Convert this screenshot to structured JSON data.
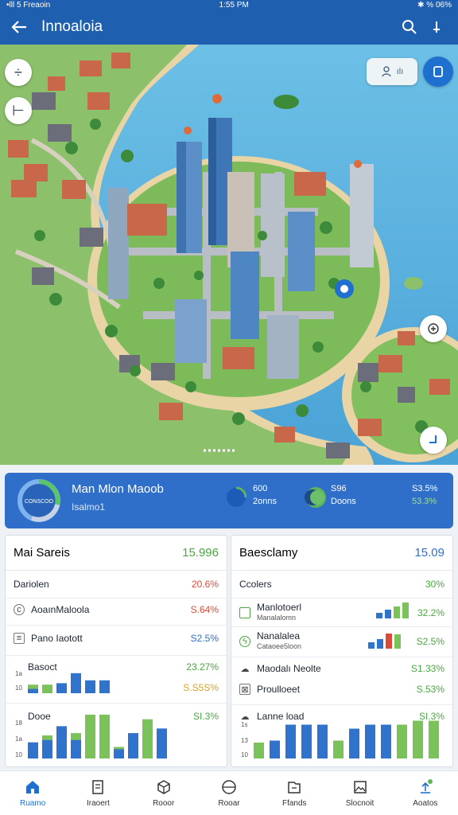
{
  "status_bar": {
    "left": "•lll 5 Freaoin",
    "time": "1:55 PM",
    "right": "✱ % 06%"
  },
  "app_bar": {
    "title": "Innoaloia",
    "back_icon": "arrow-left-icon",
    "search_icon": "search-icon",
    "menu_icon": "pin-icon"
  },
  "map": {
    "chip_text": "ılı"
  },
  "summary": {
    "title": "Man Mlon Maoob",
    "subtitle": "Isalmo1",
    "donut_label": "CONSCOO",
    "stat1_line1": "600",
    "stat1_line2": "2onns",
    "stat2_line1": "S96",
    "stat2_line2": "Doons",
    "stat3_line1": "S3.5%",
    "stat3_line2": "53.3%",
    "colors": {
      "card": "#2f6fca",
      "green": "#5cb55a",
      "blue": "#1e5bb8"
    }
  },
  "left_panel": {
    "title": "Mai Sareis",
    "total": "15.996",
    "rows": [
      {
        "label": "Dariolen",
        "value": "20.6%"
      },
      {
        "label": "AoaınMaloola",
        "value": "S.64%"
      },
      {
        "label": "Pano Iaotott",
        "value": "S2.5%"
      },
      {
        "label": "Basoct",
        "value": "23.27%"
      },
      {
        "label": "",
        "value": "S.S5S%"
      },
      {
        "label": "Dooe",
        "value": "SI.3%"
      }
    ],
    "axis1": [
      "1a",
      "10"
    ],
    "axis2": [
      "18",
      "1a",
      "10"
    ],
    "chart1": [
      {
        "blue": 0.15,
        "green": 0.3
      },
      {
        "blue": 0.0,
        "green": 0.3
      },
      {
        "blue": 0.35,
        "green": 0.3
      },
      {
        "blue": 0.7,
        "green": 0.0
      },
      {
        "blue": 0.45,
        "green": 0.0
      },
      {
        "blue": 0.45,
        "green": 0.0
      }
    ],
    "chart2": [
      {
        "blue": 0.35,
        "green": 0.0
      },
      {
        "blue": 0.4,
        "green": 0.5
      },
      {
        "blue": 0.7,
        "green": 0.0
      },
      {
        "blue": 0.4,
        "green": 0.55
      },
      {
        "blue": 0.0,
        "green": 0.95
      },
      {
        "blue": 0.0,
        "green": 0.95
      },
      {
        "blue": 0.2,
        "green": 0.25
      },
      {
        "blue": 0.55,
        "green": 0.0
      },
      {
        "blue": 0.0,
        "green": 0.85
      },
      {
        "blue": 0.65,
        "green": 0.0
      }
    ]
  },
  "right_panel": {
    "title": "Baesclamy",
    "total": "15.09",
    "rows": [
      {
        "label": "Ccolers",
        "sublabel": "",
        "value": "30%"
      },
      {
        "label": "Manlotoerl",
        "sublabel": "Manalalomn",
        "value": "32.2%"
      },
      {
        "label": "Nanalalea",
        "sublabel": "Cataoee5loon",
        "value": "S2.5%"
      },
      {
        "label": "Maodalı Neolte",
        "sublabel": "",
        "value": "S1.33%"
      },
      {
        "label": "Proulloeet",
        "sublabel": "",
        "value": "S.53%"
      },
      {
        "label": "Lanne load",
        "sublabel": "",
        "value": "SI.3%"
      }
    ],
    "axis": [
      "1s",
      "13",
      "10"
    ],
    "spark1": [
      0.35,
      0.55,
      0.75,
      1.0
    ],
    "spark2": [
      0.4,
      0.6,
      0.95,
      0.9
    ],
    "chart": [
      {
        "blue": 0.0,
        "green": 0.4
      },
      {
        "blue": 0.45,
        "green": 0.0
      },
      {
        "blue": 0.85,
        "green": 0.0
      },
      {
        "blue": 0.85,
        "green": 0.0
      },
      {
        "blue": 0.85,
        "green": 0.0
      },
      {
        "blue": 0.0,
        "green": 0.45
      },
      {
        "blue": 0.75,
        "green": 0.0
      },
      {
        "blue": 0.85,
        "green": 0.0
      },
      {
        "blue": 0.85,
        "green": 0.0
      },
      {
        "blue": 0.0,
        "green": 0.85
      },
      {
        "blue": 0.0,
        "green": 0.95
      },
      {
        "blue": 0.0,
        "green": 0.95
      }
    ]
  },
  "bottom_nav": [
    {
      "label": "Ruamo",
      "icon": "home-icon",
      "active": true
    },
    {
      "label": "Iraoert",
      "icon": "document-icon",
      "active": false
    },
    {
      "label": "Rooor",
      "icon": "box-icon",
      "active": false
    },
    {
      "label": "Rooar",
      "icon": "globe-icon",
      "active": false
    },
    {
      "label": "Ffands",
      "icon": "folder-icon",
      "active": false
    },
    {
      "label": "Slocnoit",
      "icon": "image-icon",
      "active": false
    },
    {
      "label": "Aoatos",
      "icon": "upload-icon",
      "active": false
    }
  ]
}
